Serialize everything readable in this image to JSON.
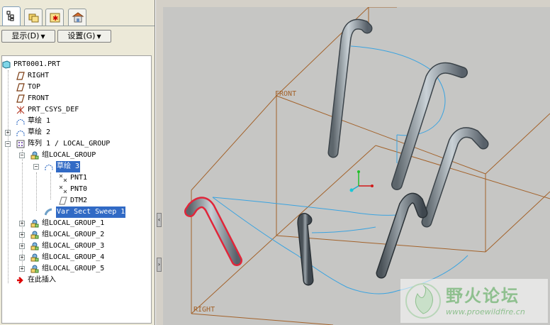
{
  "tabs": [
    {
      "icon": "model-tree-icon",
      "active": true
    },
    {
      "icon": "folder-browser-icon"
    },
    {
      "icon": "favorites-icon"
    },
    {
      "icon": "connections-icon"
    }
  ],
  "toolbar": {
    "show_label": "显示(D)",
    "settings_label": "设置(G)"
  },
  "tree": {
    "root": "PRT0001.PRT",
    "items": [
      {
        "label": "RIGHT",
        "icon": "datum-plane-icon"
      },
      {
        "label": "TOP",
        "icon": "datum-plane-icon"
      },
      {
        "label": "FRONT",
        "icon": "datum-plane-icon"
      },
      {
        "label": "PRT_CSYS_DEF",
        "icon": "csys-icon"
      },
      {
        "label": "草绘 1",
        "icon": "sketch-icon"
      },
      {
        "label": "草绘 2",
        "icon": "sketch-icon"
      },
      {
        "label": "阵列 1 / LOCAL_GROUP",
        "icon": "pattern-icon"
      },
      {
        "label": "组LOCAL_GROUP",
        "icon": "group-icon"
      },
      {
        "label": "草绘 3",
        "icon": "sketch-icon",
        "selected": true
      },
      {
        "label": "PNT1",
        "icon": "datum-point-icon"
      },
      {
        "label": "PNT0",
        "icon": "datum-point-icon"
      },
      {
        "label": "DTM2",
        "icon": "datum-plane-icon"
      },
      {
        "label": "Var Sect Sweep 1",
        "icon": "sweep-icon",
        "selected": true
      },
      {
        "label": "组LOCAL_GROUP_1",
        "icon": "group-icon"
      },
      {
        "label": "组LOCAL_GROUP_2",
        "icon": "group-icon"
      },
      {
        "label": "组LOCAL_GROUP_3",
        "icon": "group-icon"
      },
      {
        "label": "组LOCAL_GROUP_4",
        "icon": "group-icon"
      },
      {
        "label": "组LOCAL_GROUP_5",
        "icon": "group-icon"
      },
      {
        "label": "在此插入",
        "icon": "insert-here-arrow-icon"
      }
    ]
  },
  "viewport": {
    "plane_labels": {
      "front": "FRONT",
      "right": "RIGHT"
    },
    "colors": {
      "plane": "#a3622a",
      "curve": "#3aa3e0",
      "tube": "#8e979d",
      "selected": "#e0263a",
      "background": "#c6c6c4"
    }
  },
  "watermark": {
    "title": "野火论坛",
    "url": "www.proewildfire.cn"
  }
}
